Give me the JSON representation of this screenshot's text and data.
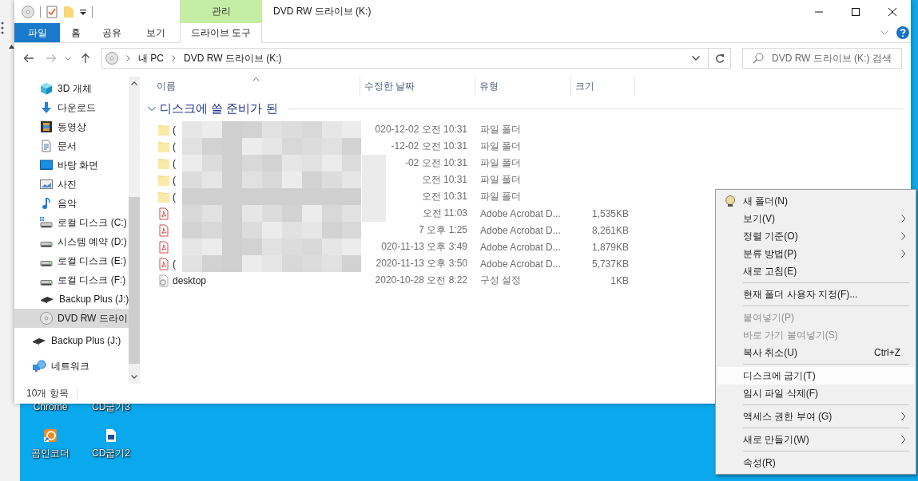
{
  "window": {
    "title": "DVD RW 드라이브 (K:)",
    "contextual_group": "관리"
  },
  "ribbon_tabs": [
    {
      "label": "파일",
      "kind": "file"
    },
    {
      "label": "홈",
      "kind": "tab"
    },
    {
      "label": "공유",
      "kind": "tab"
    },
    {
      "label": "보기",
      "kind": "tab"
    },
    {
      "label": "드라이브 도구",
      "kind": "contextual"
    }
  ],
  "address_bar": {
    "breadcrumbs": [
      "내 PC",
      "DVD RW 드라이브 (K:)"
    ]
  },
  "search": {
    "placeholder": "DVD RW 드라이브 (K:) 검색"
  },
  "sidebar": {
    "items": [
      {
        "children": [
          {
            "label": "3D 개체",
            "kind": "objects3d",
            "selected": false
          },
          {
            "label": "다운로드",
            "kind": "downloads",
            "selected": false
          },
          {
            "label": "동영상",
            "kind": "videos",
            "selected": false
          },
          {
            "label": "문서",
            "kind": "documents",
            "selected": false
          },
          {
            "label": "바탕 화면",
            "kind": "desktop",
            "selected": false
          },
          {
            "label": "사진",
            "kind": "pictures",
            "selected": false
          },
          {
            "label": "음악",
            "kind": "music",
            "selected": false
          },
          {
            "label": "로컬 디스크 (C:)",
            "kind": "system_drive",
            "selected": false
          },
          {
            "label": "시스템 예약 (D:)",
            "kind": "drive",
            "selected": false
          },
          {
            "label": "로컬 디스크 (E:)",
            "kind": "drive",
            "selected": false
          },
          {
            "label": "로컬 디스크 (F:)",
            "kind": "drive",
            "selected": false
          },
          {
            "label": "Backup Plus (J:)",
            "kind": "external_drive",
            "selected": false
          },
          {
            "label": "DVD RW 드라이",
            "kind": "optical_drive",
            "selected": true
          }
        ]
      },
      {
        "label": "Backup Plus (J:)",
        "kind": "external_drive",
        "selected": false
      },
      {
        "label": "네트워크",
        "kind": "network",
        "selected": false
      }
    ]
  },
  "columns": [
    {
      "label": "이름",
      "sorted": true
    },
    {
      "label": "수정한 날짜",
      "sorted": false
    },
    {
      "label": "유형",
      "sorted": false
    },
    {
      "label": "크기",
      "sorted": false
    }
  ],
  "group": {
    "label": "디스크에 쓸 준비가 된",
    "expanded": true
  },
  "rows": [
    {
      "kind": "folder",
      "name": "(",
      "modified": "020-12-02 오전 10:31",
      "type": "파일 폴더"
    },
    {
      "kind": "folder",
      "name": "(",
      "modified": "-12-02 오전 10:31",
      "type": "파일 폴더"
    },
    {
      "kind": "folder",
      "name": "(",
      "modified": "-02 오전 10:31",
      "type": "파일 폴더"
    },
    {
      "kind": "folder",
      "name": "(",
      "modified": "오전 10:31",
      "type": "파일 폴더"
    },
    {
      "kind": "folder",
      "name": "(",
      "modified": "오전 10:31",
      "type": "파일 폴더"
    },
    {
      "kind": "pdf",
      "modified": "오전 11:03",
      "type": "Adobe Acrobat D...",
      "size": "1,535KB"
    },
    {
      "kind": "pdf",
      "modified": "7 오후 1:25",
      "type": "Adobe Acrobat D...",
      "size": "8,261KB"
    },
    {
      "kind": "pdf",
      "modified": "020-11-13 오후 3:49",
      "type": "Adobe Acrobat D...",
      "size": "1,879KB"
    },
    {
      "kind": "pdf",
      "name": "(",
      "modified": "2020-11-13 오후 3:50",
      "type": "Adobe Acrobat D...",
      "size": "5,737KB"
    },
    {
      "kind": "settings",
      "name": "desktop",
      "modified": "2020-10-28 오전 8:22",
      "type": "구성 설정",
      "size": "1KB"
    }
  ],
  "status_bar": {
    "text": "10개 항목"
  },
  "context_menu": {
    "items": [
      {
        "kind": "item",
        "label": "새 폴더(N)",
        "icon": true,
        "submenu": false,
        "disabled": false,
        "selected": false
      },
      {
        "kind": "item",
        "label": "보기(V)",
        "submenu": true,
        "disabled": false,
        "selected": false
      },
      {
        "kind": "item",
        "label": "정렬 기준(O)",
        "submenu": true,
        "disabled": false,
        "selected": false
      },
      {
        "kind": "item",
        "label": "분류 방법(P)",
        "submenu": true,
        "disabled": false,
        "selected": false
      },
      {
        "kind": "item",
        "label": "새로 고침(E)",
        "submenu": false,
        "disabled": false,
        "selected": false
      },
      {
        "kind": "separator"
      },
      {
        "kind": "item",
        "label": "현재 폴더 사용자 지정(F)...",
        "submenu": false,
        "disabled": false,
        "selected": false
      },
      {
        "kind": "separator"
      },
      {
        "kind": "item",
        "label": "붙여넣기(P)",
        "submenu": false,
        "disabled": true,
        "selected": false
      },
      {
        "kind": "item",
        "label": "바로 가기 붙여넣기(S)",
        "submenu": false,
        "disabled": true,
        "selected": false
      },
      {
        "kind": "item",
        "label": "복사 취소(U)",
        "shortcut": "Ctrl+Z",
        "submenu": false,
        "disabled": false,
        "selected": false
      },
      {
        "kind": "separator"
      },
      {
        "kind": "item",
        "label": "디스크에 굽기(T)",
        "submenu": false,
        "disabled": false,
        "selected": true
      },
      {
        "kind": "item",
        "label": "임시 파일 삭제(F)",
        "submenu": false,
        "disabled": false,
        "selected": false
      },
      {
        "kind": "separator"
      },
      {
        "kind": "item",
        "label": "액세스 권한 부여 (G)",
        "submenu": true,
        "disabled": false,
        "selected": false
      },
      {
        "kind": "separator"
      },
      {
        "kind": "item",
        "label": "새로 만들기(W)",
        "submenu": true,
        "disabled": false,
        "selected": false
      },
      {
        "kind": "separator"
      },
      {
        "kind": "item",
        "label": "속성(R)",
        "submenu": false,
        "disabled": false,
        "selected": false
      }
    ]
  },
  "desktop": {
    "icons": [
      {
        "label": "Chrome",
        "kind": "hidden"
      },
      {
        "label": "CD굽기3",
        "kind": "hidden"
      },
      {
        "label": "곰인코더",
        "kind": "app"
      },
      {
        "label": "CD굽기2",
        "kind": "file"
      }
    ]
  }
}
